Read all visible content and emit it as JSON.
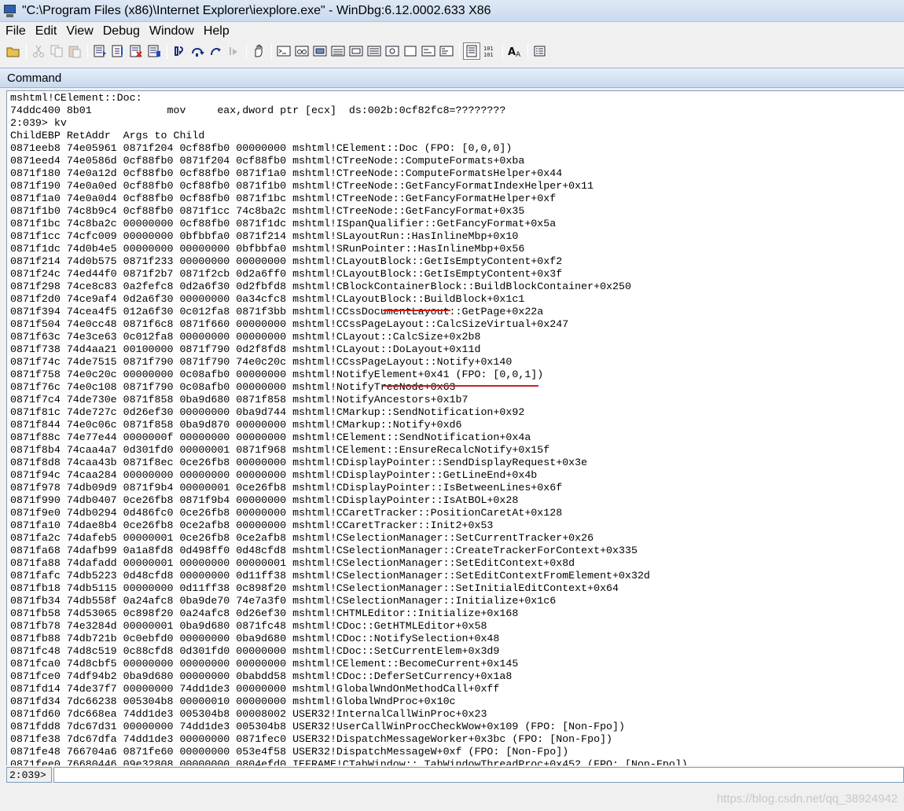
{
  "window": {
    "title": "\"C:\\Program Files (x86)\\Internet Explorer\\iexplore.exe\" - WinDbg:6.12.0002.633 X86"
  },
  "menu": [
    {
      "label": "File"
    },
    {
      "label": "Edit"
    },
    {
      "label": "View"
    },
    {
      "label": "Debug"
    },
    {
      "label": "Window"
    },
    {
      "label": "Help"
    }
  ],
  "toolbar": {
    "icons": [
      "open-icon",
      "cut-icon",
      "copy-icon",
      "paste-icon",
      "go-icon",
      "restart-icon",
      "stop-debugging-icon",
      "break-icon",
      "step-into-icon",
      "step-over-icon",
      "step-out-icon",
      "run-to-cursor-icon",
      "hand-icon",
      "command-window-icon",
      "watch-window-icon",
      "locals-window-icon",
      "registers-window-icon",
      "memory-window-icon",
      "call-stack-window-icon",
      "disassembly-window-icon",
      "scratch-pad-icon",
      "processes-threads-icon",
      "source-mode-icon",
      "hex-mode-icon",
      "font-icon",
      "options-icon"
    ]
  },
  "command_window": {
    "title": "Command",
    "lines": [
      "mshtml!CElement::Doc:",
      "74ddc400 8b01            mov     eax,dword ptr [ecx]  ds:002b:0cf82fc8=????????",
      "2:039> kv",
      "ChildEBP RetAddr  Args to Child",
      "0871eeb8 74e05961 0871f204 0cf88fb0 00000000 mshtml!CElement::Doc (FPO: [0,0,0])",
      "0871eed4 74e0586d 0cf88fb0 0871f204 0cf88fb0 mshtml!CTreeNode::ComputeFormats+0xba",
      "0871f180 74e0a12d 0cf88fb0 0cf88fb0 0871f1a0 mshtml!CTreeNode::ComputeFormatsHelper+0x44",
      "0871f190 74e0a0ed 0cf88fb0 0cf88fb0 0871f1b0 mshtml!CTreeNode::GetFancyFormatIndexHelper+0x11",
      "0871f1a0 74e0a0d4 0cf88fb0 0cf88fb0 0871f1bc mshtml!CTreeNode::GetFancyFormatHelper+0xf",
      "0871f1b0 74c8b9c4 0cf88fb0 0871f1cc 74c8ba2c mshtml!CTreeNode::GetFancyFormat+0x35",
      "0871f1bc 74c8ba2c 00000000 0cf88fb0 0871f1dc mshtml!ISpanQualifier::GetFancyFormat+0x5a",
      "0871f1cc 74cfc009 00000000 0bfbbfa0 0871f214 mshtml!SLayoutRun::HasInlineMbp+0x10",
      "0871f1dc 74d0b4e5 00000000 00000000 0bfbbfa0 mshtml!SRunPointer::HasInlineMbp+0x56",
      "0871f214 74d0b575 0871f233 00000000 00000000 mshtml!CLayoutBlock::GetIsEmptyContent+0xf2",
      "0871f24c 74ed44f0 0871f2b7 0871f2cb 0d2a6ff0 mshtml!CLayoutBlock::GetIsEmptyContent+0x3f",
      "0871f298 74ce8c83 0a2fefc8 0d2a6f30 0d2fbfd8 mshtml!CBlockContainerBlock::BuildBlockContainer+0x250",
      "0871f2d0 74ce9af4 0d2a6f30 00000000 0a34cfc8 mshtml!CLayoutBlock::BuildBlock+0x1c1",
      "0871f394 74cea4f5 012a6f30 0c012fa8 0871f3bb mshtml!CCssDocumentLayout::GetPage+0x22a",
      "0871f504 74e0cc48 0871f6c8 0871f660 00000000 mshtml!CCssPageLayout::CalcSizeVirtual+0x247",
      "0871f63c 74e3ce63 0c012fa8 00000000 00000000 mshtml!CLayout::CalcSize+0x2b8",
      "0871f738 74d4aa21 00100000 0871f790 0d2f8fd8 mshtml!CLayout::DoLayout+0x11d",
      "0871f74c 74de7515 0871f790 0871f790 74e0c20c mshtml!CCssPageLayout::Notify+0x140",
      "0871f758 74e0c20c 00000000 0c08afb0 00000000 mshtml!NotifyElement+0x41 (FPO: [0,0,1])",
      "0871f76c 74e0c108 0871f790 0c08afb0 00000000 mshtml!NotifyTreeNode+0x63",
      "0871f7c4 74de730e 0871f858 0ba9d680 0871f858 mshtml!NotifyAncestors+0x1b7",
      "0871f81c 74de727c 0d26ef30 00000000 0ba9d744 mshtml!CMarkup::SendNotification+0x92",
      "0871f844 74e0c06c 0871f858 0ba9d870 00000000 mshtml!CMarkup::Notify+0xd6",
      "0871f88c 74e77e44 0000000f 00000000 00000000 mshtml!CElement::SendNotification+0x4a",
      "0871f8b4 74caa4a7 0d301fd0 00000001 0871f968 mshtml!CElement::EnsureRecalcNotify+0x15f",
      "0871f8d8 74caa43b 0871f8ec 0ce26fb8 00000000 mshtml!CDisplayPointer::SendDisplayRequest+0x3e",
      "0871f94c 74caa284 00000000 00000000 00000000 mshtml!CDisplayPointer::GetLineEnd+0x4b",
      "0871f978 74db09d9 0871f9b4 00000001 0ce26fb8 mshtml!CDisplayPointer::IsBetweenLines+0x6f",
      "0871f990 74db0407 0ce26fb8 0871f9b4 00000000 mshtml!CDisplayPointer::IsAtBOL+0x28",
      "0871f9e0 74db0294 0d486fc0 0ce26fb8 00000000 mshtml!CCaretTracker::PositionCaretAt+0x128",
      "0871fa10 74dae8b4 0ce26fb8 0ce2afb8 00000000 mshtml!CCaretTracker::Init2+0x53",
      "0871fa2c 74dafeb5 00000001 0ce26fb8 0ce2afb8 mshtml!CSelectionManager::SetCurrentTracker+0x26",
      "0871fa68 74dafb99 0a1a8fd8 0d498ff0 0d48cfd8 mshtml!CSelectionManager::CreateTrackerForContext+0x335",
      "0871fa88 74dafadd 00000001 00000000 00000001 mshtml!CSelectionManager::SetEditContext+0x8d",
      "0871fafc 74db5223 0d48cfd8 00000000 0d11ff38 mshtml!CSelectionManager::SetEditContextFromElement+0x32d",
      "0871fb18 74db5115 00000000 0d11ff38 0c898f20 mshtml!CSelectionManager::SetInitialEditContext+0x64",
      "0871fb34 74db558f 0a24afc8 0ba9de70 74e7a3f0 mshtml!CSelectionManager::Initialize+0x1c6",
      "0871fb58 74d53065 0c898f20 0a24afc8 0d26ef30 mshtml!CHTMLEditor::Initialize+0x168",
      "0871fb78 74e3284d 00000001 0ba9d680 0871fc48 mshtml!CDoc::GetHTMLEditor+0x58",
      "0871fb88 74db721b 0c0ebfd0 00000000 0ba9d680 mshtml!CDoc::NotifySelection+0x48",
      "0871fc48 74d8c519 0c88cfd8 0d301fd0 00000000 mshtml!CDoc::SetCurrentElem+0x3d9",
      "0871fca0 74d8cbf5 00000000 00000000 00000000 mshtml!CElement::BecomeCurrent+0x145",
      "0871fce0 74df94b2 0ba9d680 00000000 0babdd58 mshtml!CDoc::DeferSetCurrency+0x1a8",
      "0871fd14 74de37f7 00000000 74dd1de3 00000000 mshtml!GlobalWndOnMethodCall+0xff",
      "0871fd34 7dc66238 005304b8 00000010 00000000 mshtml!GlobalWndProc+0x10c",
      "0871fd60 7dc668ea 74dd1de3 005304b8 00008002 USER32!InternalCallWinProc+0x23",
      "0871fdd8 7dc67d31 00000000 74dd1de3 005304b8 USER32!UserCallWinProcCheckWow+0x109 (FPO: [Non-Fpo])",
      "0871fe38 7dc67dfa 74dd1de3 00000000 0871fec0 USER32!DispatchMessageWorker+0x3bc (FPO: [Non-Fpo])",
      "0871fe48 766704a6 0871fe60 00000000 053e4f58 USER32!DispatchMessageW+0xf (FPO: [Non-Fpo])",
      "0871fee0 76680446 09e32808 00000000 0804efd0 IEFRAME!CTabWindow::_TabWindowThreadProc+0x452 (FPO: [Non-Fpo])"
    ],
    "prompt": "2:039>",
    "input_value": ""
  },
  "watermark": "https://blog.csdn.net/qq_38924942"
}
